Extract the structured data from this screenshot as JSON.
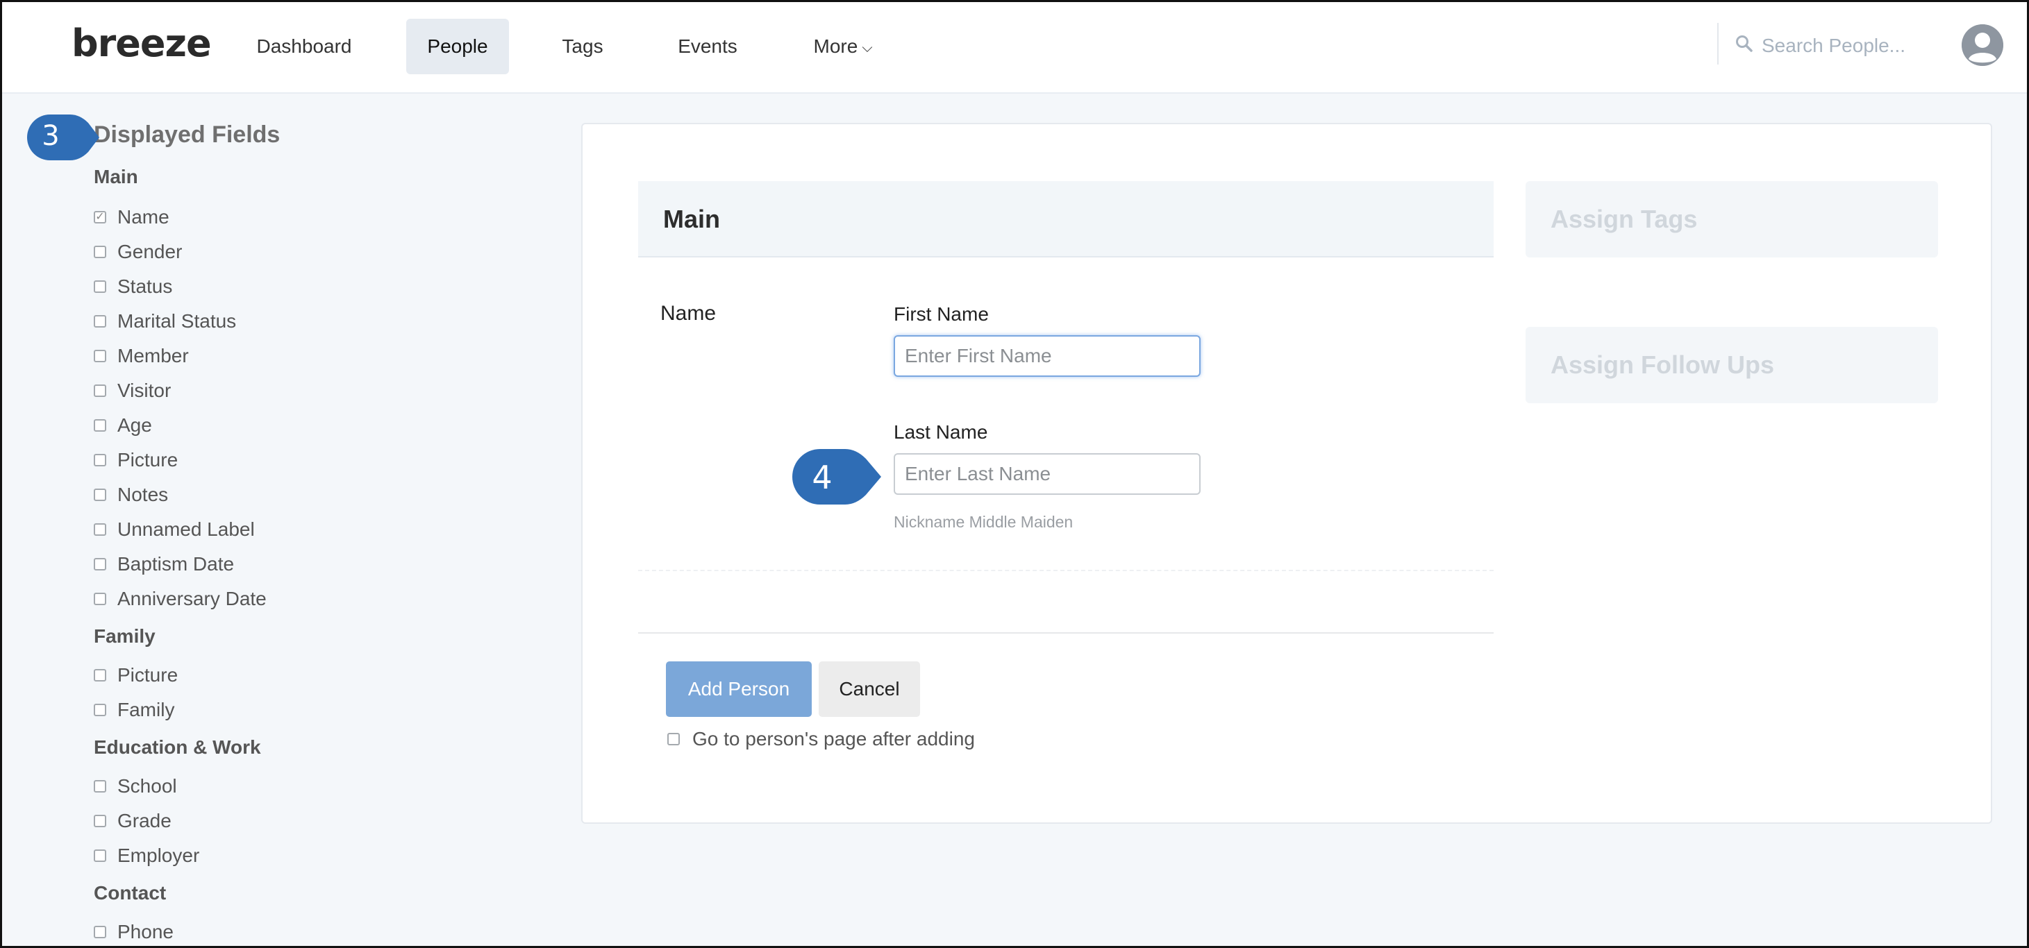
{
  "nav": {
    "logo": "breeze",
    "items": [
      {
        "label": "Dashboard"
      },
      {
        "label": "People"
      },
      {
        "label": "Tags"
      },
      {
        "label": "Events"
      },
      {
        "label": "More"
      }
    ],
    "active": "People",
    "search_placeholder": "Search People...",
    "icons": {
      "search": "search-icon",
      "avatar": "user-avatar-icon",
      "more": "chevron-down-icon"
    }
  },
  "sidebar": {
    "title": "Displayed Fields",
    "groups": [
      {
        "name": "Main",
        "items": [
          {
            "label": "Name",
            "checked": true
          },
          {
            "label": "Gender",
            "checked": false
          },
          {
            "label": "Status",
            "checked": false
          },
          {
            "label": "Marital Status",
            "checked": false
          },
          {
            "label": "Member",
            "checked": false
          },
          {
            "label": "Visitor",
            "checked": false
          },
          {
            "label": "Age",
            "checked": false
          },
          {
            "label": "Picture",
            "checked": false
          },
          {
            "label": "Notes",
            "checked": false
          },
          {
            "label": "Unnamed Label",
            "checked": false
          },
          {
            "label": "Baptism Date",
            "checked": false
          },
          {
            "label": "Anniversary Date",
            "checked": false
          }
        ]
      },
      {
        "name": "Family",
        "items": [
          {
            "label": "Picture",
            "checked": false
          },
          {
            "label": "Family",
            "checked": false
          }
        ]
      },
      {
        "name": "Education & Work",
        "items": [
          {
            "label": "School",
            "checked": false
          },
          {
            "label": "Grade",
            "checked": false
          },
          {
            "label": "Employer",
            "checked": false
          }
        ]
      },
      {
        "name": "Contact",
        "items": [
          {
            "label": "Phone",
            "checked": false
          }
        ]
      }
    ]
  },
  "form": {
    "section_title": "Main",
    "assign_tags": "Assign Tags",
    "assign_follow_ups": "Assign Follow Ups",
    "name_label": "Name",
    "first_name_label": "First Name",
    "first_name_placeholder": "Enter First Name",
    "first_name_value": "",
    "last_name_label": "Last Name",
    "last_name_placeholder": "Enter Last Name",
    "last_name_value": "",
    "hint": "Nickname Middle Maiden",
    "add_button": "Add Person",
    "cancel_button": "Cancel",
    "goto_label": "Go to person's page after adding",
    "goto_checked": false
  },
  "callouts": [
    {
      "number": "3",
      "target": "Displayed Fields"
    },
    {
      "number": "4",
      "target": "Last Name field"
    }
  ],
  "colors": {
    "accent": "#7ba7d9",
    "callout": "#2f6db5",
    "nav_active_bg": "#e6ebf1",
    "page_bg": "#f4f7fa"
  }
}
